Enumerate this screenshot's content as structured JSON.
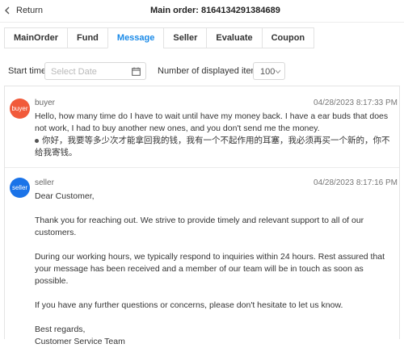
{
  "header": {
    "back_label": "Return",
    "main_order": "Main order: 8164134291384689"
  },
  "tabs": [
    {
      "label": "MainOrder"
    },
    {
      "label": "Fund"
    },
    {
      "label": "Message"
    },
    {
      "label": "Seller"
    },
    {
      "label": "Evaluate"
    },
    {
      "label": "Coupon"
    }
  ],
  "active_tab": "Message",
  "filter": {
    "start_time_label": "Start time:",
    "date_placeholder": "Select Date",
    "items_label": "Number of displayed items:",
    "items_value": "100"
  },
  "messages": [
    {
      "avatar_text": "buyer",
      "avatar_color": "#f15a3a",
      "sender": "buyer",
      "time": "04/28/2023 8:17:33 PM",
      "text": "Hello, how many time do I have to wait until have my money back. I have a ear buds that does not work, I had to buy another new ones, and you don't send me the money.",
      "translation": "你好，我要等多少次才能拿回我的钱，我有一个不起作用的耳塞，我必须再买一个新的，你不给我寄钱。"
    },
    {
      "avatar_text": "seller",
      "avatar_color": "#1a73e8",
      "sender": "seller",
      "time": "04/28/2023 8:17:16 PM",
      "paragraphs": [
        "Dear Customer,",
        "Thank you for reaching out. We strive to provide timely and relevant support to all of our customers.",
        "During our working hours, we typically respond to inquiries within 24 hours. Rest assured that your message has been received and a member of our team will be in touch as soon as possible.",
        "If you have any further questions or concerns, please don't hesitate to let us know.",
        "Best regards,",
        "Customer Service Team"
      ]
    }
  ]
}
